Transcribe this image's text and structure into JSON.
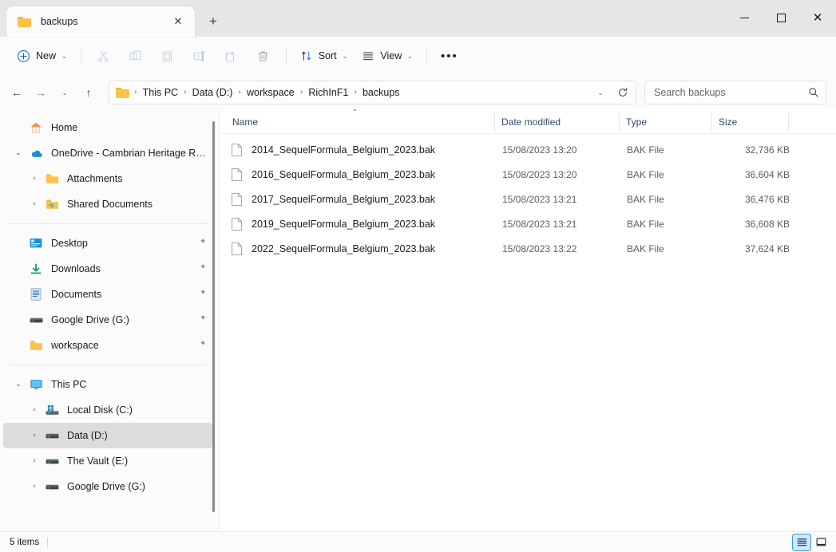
{
  "window": {
    "tab_title": "backups",
    "tab_close_label": "✕",
    "new_tab_label": "+",
    "minimize_label": "",
    "maximize_label": "",
    "close_label": "✕"
  },
  "toolbar": {
    "new_label": "New",
    "new_chevron": "⌄",
    "cut_icon": "cut-icon",
    "copy_icon": "copy-icon",
    "paste_icon": "paste-icon",
    "rename_icon": "rename-icon",
    "share_icon": "share-icon",
    "delete_icon": "delete-icon",
    "sort_label": "Sort",
    "sort_chevron": "⌄",
    "view_label": "View",
    "view_chevron": "⌄",
    "more_label": "•••"
  },
  "addressbar": {
    "back_icon": "←",
    "forward_icon": "→",
    "recent_icon": "⌄",
    "up_icon": "↑",
    "breadcrumbs": [
      "This PC",
      "Data (D:)",
      "workspace",
      "RichInF1",
      "backups"
    ],
    "separator": "›",
    "dropdown_icon": "⌄",
    "refresh_icon": "↻"
  },
  "search": {
    "placeholder": "Search backups",
    "value": "",
    "icon": "search-icon"
  },
  "sidebar": {
    "groups": [
      {
        "items": [
          {
            "label": "Home",
            "icon": "home-icon",
            "indent": 0,
            "expander": "",
            "pinned": false,
            "selected": false
          },
          {
            "label": "OneDrive - Cambrian Heritage Railways",
            "icon": "onedrive-icon",
            "indent": 0,
            "expander": "⌄",
            "pinned": false,
            "selected": false
          },
          {
            "label": "Attachments",
            "icon": "folder-icon",
            "indent": 1,
            "expander": "›",
            "pinned": false,
            "selected": false
          },
          {
            "label": "Shared Documents",
            "icon": "shared-folder-icon",
            "indent": 1,
            "expander": "›",
            "pinned": false,
            "selected": false
          }
        ]
      },
      {
        "items": [
          {
            "label": "Desktop",
            "icon": "desktop-icon",
            "indent": 0,
            "expander": "",
            "pinned": true,
            "selected": false
          },
          {
            "label": "Downloads",
            "icon": "downloads-icon",
            "indent": 0,
            "expander": "",
            "pinned": true,
            "selected": false
          },
          {
            "label": "Documents",
            "icon": "documents-icon",
            "indent": 0,
            "expander": "",
            "pinned": true,
            "selected": false
          },
          {
            "label": "Google Drive (G:)",
            "icon": "drive-icon",
            "indent": 0,
            "expander": "",
            "pinned": true,
            "selected": false
          },
          {
            "label": "workspace",
            "icon": "folder-icon",
            "indent": 0,
            "expander": "",
            "pinned": true,
            "selected": false
          }
        ]
      },
      {
        "items": [
          {
            "label": "This PC",
            "icon": "pc-icon",
            "indent": 0,
            "expander": "⌄",
            "pinned": false,
            "selected": false
          },
          {
            "label": "Local Disk (C:)",
            "icon": "windows-disk-icon",
            "indent": 1,
            "expander": "›",
            "pinned": false,
            "selected": false
          },
          {
            "label": "Data (D:)",
            "icon": "drive-icon",
            "indent": 1,
            "expander": "›",
            "pinned": false,
            "selected": true
          },
          {
            "label": "The Vault (E:)",
            "icon": "drive-icon",
            "indent": 1,
            "expander": "›",
            "pinned": false,
            "selected": false
          },
          {
            "label": "Google Drive (G:)",
            "icon": "drive-icon",
            "indent": 1,
            "expander": "›",
            "pinned": false,
            "selected": false
          }
        ]
      }
    ],
    "pin_glyph": "\u0001"
  },
  "filelist": {
    "columns": {
      "name": "Name",
      "date": "Date modified",
      "type": "Type",
      "size": "Size"
    },
    "sort_indicator": "⌃",
    "rows": [
      {
        "name": "2014_SequelFormula_Belgium_2023.bak",
        "date": "15/08/2023 13:20",
        "type": "BAK File",
        "size": "32,736 KB"
      },
      {
        "name": "2016_SequelFormula_Belgium_2023.bak",
        "date": "15/08/2023 13:20",
        "type": "BAK File",
        "size": "36,604 KB"
      },
      {
        "name": "2017_SequelFormula_Belgium_2023.bak",
        "date": "15/08/2023 13:21",
        "type": "BAK File",
        "size": "36,476 KB"
      },
      {
        "name": "2019_SequelFormula_Belgium_2023.bak",
        "date": "15/08/2023 13:21",
        "type": "BAK File",
        "size": "36,608 KB"
      },
      {
        "name": "2022_SequelFormula_Belgium_2023.bak",
        "date": "15/08/2023 13:22",
        "type": "BAK File",
        "size": "37,624 KB"
      }
    ]
  },
  "statusbar": {
    "item_count": "5 items",
    "details_view_icon": "details-view-icon",
    "large_icons_view_icon": "large-icons-view-icon"
  },
  "colors": {
    "accent": "#0067c0",
    "selection": "#dcdcdc",
    "folder": "#fbc34a",
    "header_text": "#2f4a6d",
    "view_active": "#cfe8fb"
  }
}
